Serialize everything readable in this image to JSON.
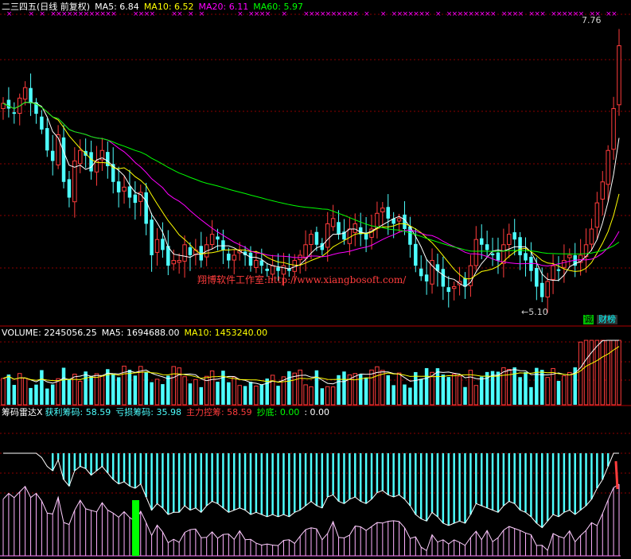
{
  "price_panel": {
    "title": "二三四五(日线 前复权)",
    "ma5_label": "MA5: 6.84",
    "ma10_label": "MA10: 6.52",
    "ma20_label": "MA20: 6.11",
    "ma60_label": "MA60: 5.97",
    "high_marker": "7.76",
    "low_marker": "←5.10",
    "watermark": "翔博软件工作室:http://www.xiangbosoft.com/",
    "badge_jian": "诚",
    "badge_caibang": "财榜"
  },
  "volume_panel": {
    "volume_label": "VOLUME: 2245056.25",
    "ma5_label": "MA5: 1694688.00",
    "ma10_label": "MA10: 1453240.00"
  },
  "chip_panel": {
    "title": "筹码雷达X",
    "profit_label": "获利筹码: 58.59",
    "loss_label": "亏损筹码: 35.98",
    "main_label": "主力控筹: 58.59",
    "bottom_label": "抄底: 0.00",
    "extra_label": ": 0.00"
  },
  "colors": {
    "background": "#000000",
    "up": "#ff3c3c",
    "down": "#4dffff",
    "ma5": "#ffffff",
    "ma10": "#ffff00",
    "ma20": "#ff00ff",
    "ma60": "#00ff00",
    "grid": "#8b0000",
    "cross_marks": "#ff00ff",
    "watermark": "#ff3c3c"
  },
  "chart_data": {
    "type": "candlestick",
    "price_range": [
      5.0,
      7.9
    ],
    "high": 7.76,
    "low": 5.1,
    "last_values": {
      "ma5": 6.84,
      "ma10": 6.52,
      "ma20": 6.11,
      "ma60": 5.97,
      "volume": 2245056.25,
      "vol_ma5": 1694688.0,
      "vol_ma10": 1453240.0,
      "profit_chips": 58.59,
      "loss_chips": 35.98,
      "main_control": 58.59,
      "bottom": 0.0
    },
    "closes": [
      7.05,
      7.0,
      6.95,
      7.1,
      7.2,
      7.05,
      6.95,
      6.8,
      6.6,
      6.5,
      6.75,
      6.3,
      6.15,
      6.5,
      6.6,
      6.55,
      6.4,
      6.5,
      6.6,
      6.45,
      6.3,
      6.2,
      6.25,
      6.15,
      6.1,
      6.2,
      5.9,
      5.6,
      5.75,
      5.65,
      5.5,
      5.55,
      5.55,
      5.7,
      5.6,
      5.65,
      5.55,
      5.7,
      5.8,
      5.75,
      5.65,
      5.55,
      5.6,
      5.65,
      5.6,
      5.5,
      5.55,
      5.5,
      5.45,
      5.5,
      5.45,
      5.5,
      5.45,
      5.55,
      5.6,
      5.7,
      5.8,
      5.7,
      5.65,
      5.9,
      5.95,
      5.8,
      5.75,
      5.85,
      5.9,
      5.8,
      5.75,
      5.85,
      6.0,
      6.05,
      5.95,
      5.9,
      5.95,
      5.85,
      5.7,
      5.5,
      5.4,
      5.35,
      5.55,
      5.45,
      5.3,
      5.25,
      5.3,
      5.35,
      5.3,
      5.5,
      5.75,
      5.7,
      5.65,
      5.6,
      5.55,
      5.7,
      5.8,
      5.75,
      5.6,
      5.55,
      5.45,
      5.3,
      5.2,
      5.35,
      5.5,
      5.45,
      5.55,
      5.6,
      5.5,
      5.6,
      5.7,
      5.85,
      6.1,
      6.3,
      6.6,
      7.0,
      7.6
    ]
  }
}
